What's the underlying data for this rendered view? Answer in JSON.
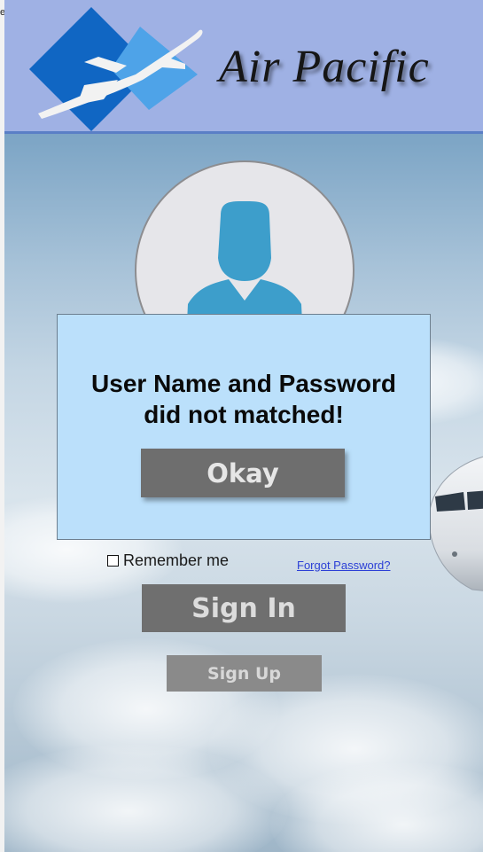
{
  "window": {
    "left_fragment_text": "e"
  },
  "header": {
    "brand_name": "Air Pacific",
    "logo_icon": "airplane-diamond-logo",
    "background_color": "#9fb1e4"
  },
  "avatar": {
    "icon": "user-avatar-icon",
    "color": "#3d9ecb"
  },
  "dialog": {
    "message": "User Name and Password\ndid not matched!",
    "okay_label": "Okay",
    "background_color": "#bbe0fb"
  },
  "login": {
    "remember_label": "Remember me",
    "remember_checked": false,
    "forgot_label": "Forgot Password?",
    "signin_label": "Sign In",
    "signup_label": "Sign Up"
  },
  "colors": {
    "button_gray": "#6f6f6f",
    "link_blue": "#2b3fd6"
  }
}
